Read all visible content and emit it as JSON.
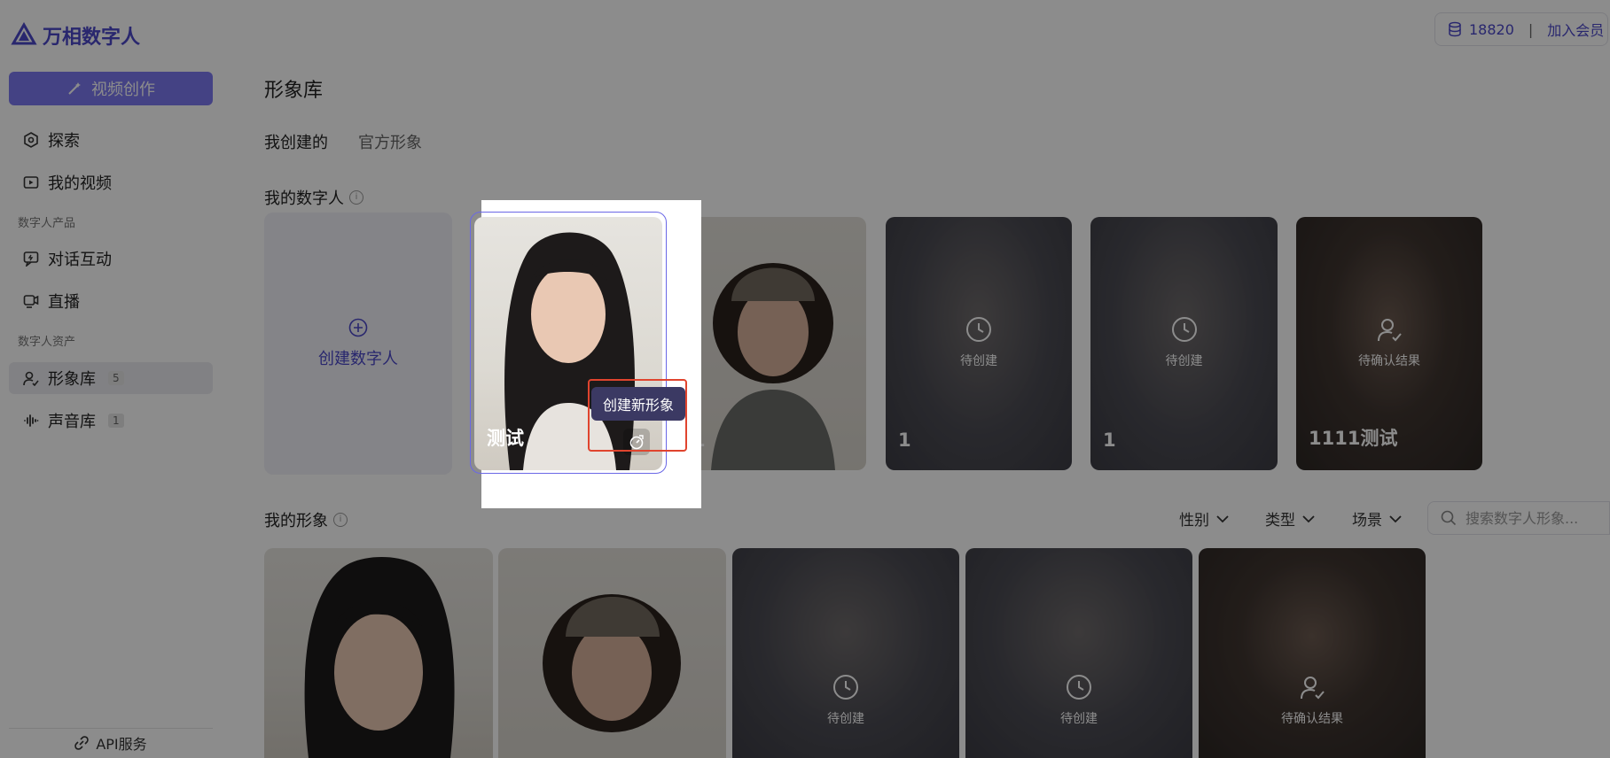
{
  "brand": {
    "name": "万相数字人"
  },
  "sidebar": {
    "create_video_label": "视频创作",
    "items": [
      {
        "label": "探索",
        "icon": "explore-icon"
      },
      {
        "label": "我的视频",
        "icon": "video-icon"
      }
    ],
    "section_products": "数字人产品",
    "product_items": [
      {
        "label": "对话互动",
        "icon": "chat-icon"
      },
      {
        "label": "直播",
        "icon": "live-icon"
      }
    ],
    "section_assets": "数字人资产",
    "asset_items": [
      {
        "label": "形象库",
        "badge": "5",
        "icon": "avatar-library-icon",
        "active": true
      },
      {
        "label": "声音库",
        "badge": "1",
        "icon": "audio-wave-icon",
        "active": false
      }
    ],
    "api_label": "API服务"
  },
  "topbar": {
    "credits": "18820",
    "separator": "|",
    "join_label": "加入会员"
  },
  "main": {
    "title": "形象库",
    "tabs": [
      {
        "label": "我创建的",
        "active": true
      },
      {
        "label": "官方形象",
        "active": false
      }
    ],
    "digital_humans": {
      "title": "我的数字人",
      "create_label": "创建数字人",
      "cards": [
        {
          "name": "测试",
          "status": ""
        },
        {
          "name": "1",
          "status": ""
        },
        {
          "name": "1",
          "status": "待创建"
        },
        {
          "name": "1",
          "status": "待创建"
        },
        {
          "name": "1111测试",
          "status": "待确认结果"
        }
      ]
    },
    "images": {
      "title": "我的形象",
      "filters": [
        "性别",
        "类型",
        "场景"
      ],
      "search_placeholder": "搜索数字人形象...",
      "cards": [
        {
          "status": ""
        },
        {
          "status": ""
        },
        {
          "status": "待创建"
        },
        {
          "status": "待创建"
        },
        {
          "status": "待确认结果"
        }
      ]
    }
  },
  "tooltip": {
    "label": "创建新形象"
  },
  "colors": {
    "accent": "#4b47c9",
    "button": "#7c79f0",
    "highlight": "#e0442e",
    "overlay": "rgba(0,0,0,0.45)"
  }
}
